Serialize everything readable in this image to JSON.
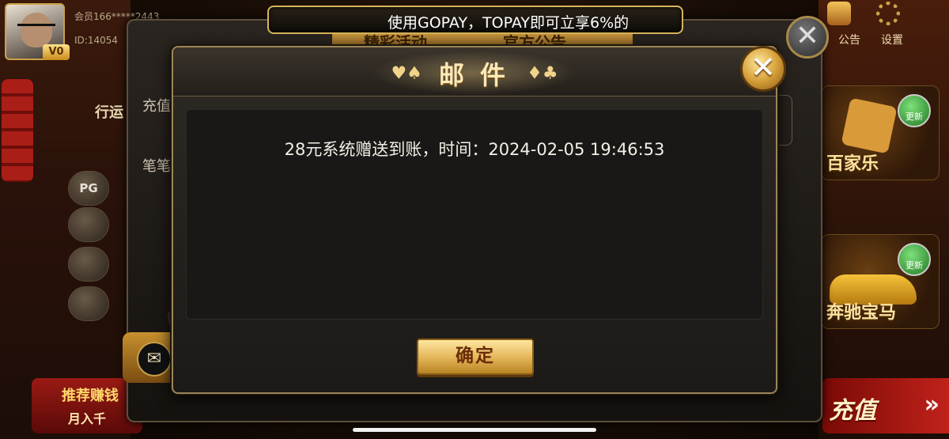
{
  "lobby": {
    "member_label": "会员166*****2443",
    "id_label": "ID:14054",
    "vip_badge": "V0",
    "side_chip_pg": "PG",
    "row_recharge": "充值",
    "row_each": "笔笔",
    "top_tab_1": "精彩活动",
    "top_tab_2": "官方公告",
    "notice_label": "公告",
    "settings_label": "设置",
    "baccarat_label": "百家乐",
    "benz_label": "奔驰宝马",
    "update_label": "更新",
    "recharge_label": "充值",
    "recharge_arrow": "»",
    "promo_line1": "推荐赚钱",
    "promo_line2": "月入千",
    "left_tab_text": "行运"
  },
  "marquee": {
    "text": "使用GOPAY，TOPAY即可立享6%的"
  },
  "dialog": {
    "title": "邮件",
    "suit_left": "♥♠",
    "suit_right": "♦♣",
    "message": "28元系统赠送到账，时间：2024-02-05 19:46:53",
    "confirm_label": "确定",
    "close_glyph": "✕"
  },
  "colors": {
    "gold_border": "#d8b45a",
    "dialog_bg": "#1c1a17",
    "confirm_gold": "#e2b456"
  },
  "icons": {
    "close": "close-icon",
    "mail": "mail-icon",
    "settings": "gear-icon",
    "notice": "chest-icon"
  }
}
